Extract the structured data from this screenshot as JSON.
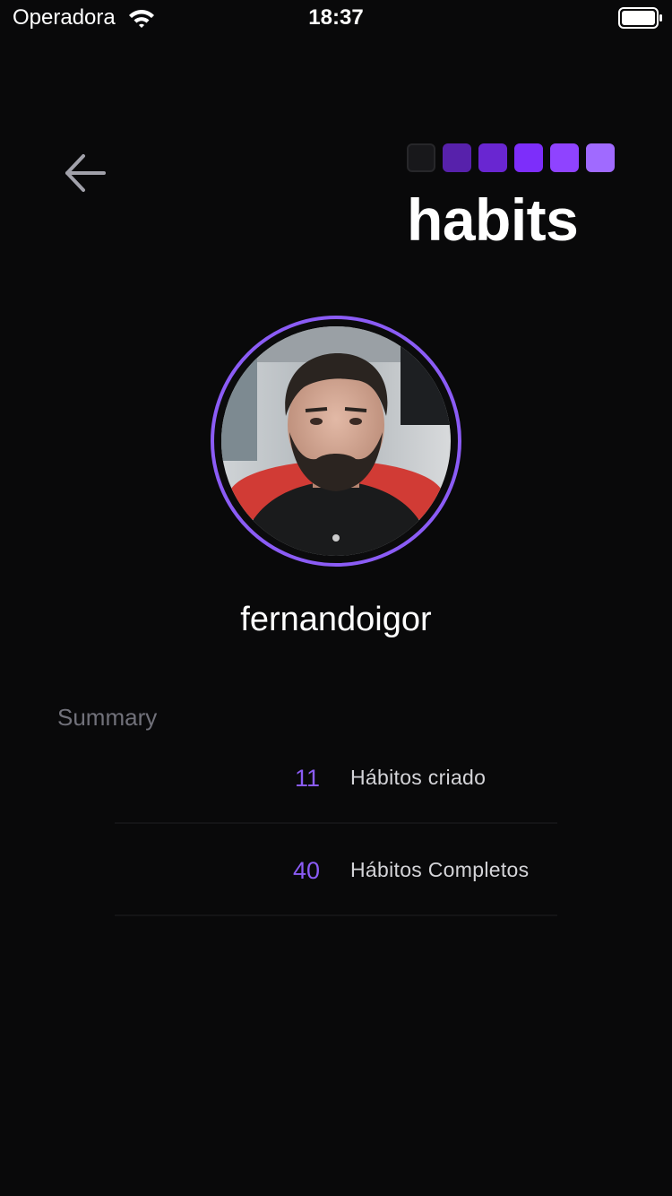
{
  "status_bar": {
    "carrier": "Operadora",
    "time": "18:37",
    "wifi_icon": "wifi-icon",
    "battery_icon": "battery-full-icon"
  },
  "header": {
    "back_icon": "arrow-left-icon",
    "logo_text": "habits",
    "logo_squares": [
      "#18181b",
      "#4c1d95",
      "#5b21b6",
      "#6d28d9",
      "#7c3aed",
      "#8b5cf6"
    ]
  },
  "profile": {
    "username": "fernandoigor",
    "avatar_border_color": "#8b5cf6"
  },
  "summary": {
    "title": "Summary",
    "stats": [
      {
        "value": "11",
        "label": "Hábitos criado"
      },
      {
        "value": "40",
        "label": "Hábitos Completos"
      }
    ]
  },
  "colors": {
    "background": "#09090a",
    "accent": "#8b5cf6",
    "muted_text": "#71717a"
  }
}
